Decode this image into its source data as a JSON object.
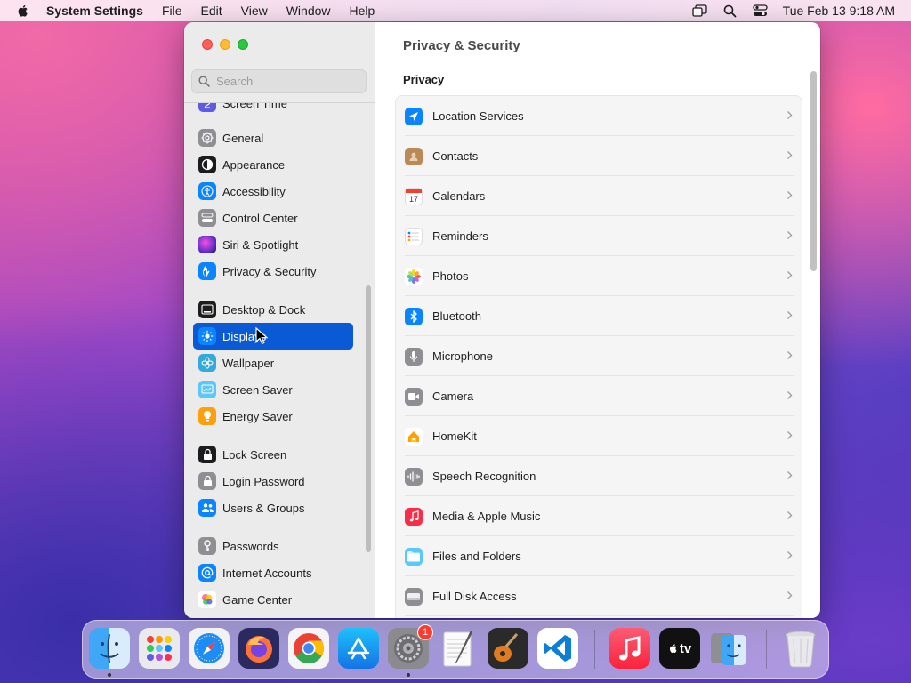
{
  "menubar": {
    "app_name": "System Settings",
    "menus": [
      "File",
      "Edit",
      "View",
      "Window",
      "Help"
    ],
    "clock": "Tue Feb 13  9:18 AM"
  },
  "window": {
    "search_placeholder": "Search",
    "partial_item": "Screen Time",
    "sidebar_groups": [
      [
        {
          "label": "General",
          "icon": "gear-icon",
          "color": "#8e8e93"
        },
        {
          "label": "Appearance",
          "icon": "appearance-icon",
          "color": "#1c1c1e"
        },
        {
          "label": "Accessibility",
          "icon": "accessibility-icon",
          "color": "#0a84ff"
        },
        {
          "label": "Control Center",
          "icon": "control-center-icon",
          "color": "#8e8e93"
        },
        {
          "label": "Siri & Spotlight",
          "icon": "siri-icon",
          "color": "#5e2fd0"
        },
        {
          "label": "Privacy & Security",
          "icon": "hand-icon",
          "color": "#0a84ff"
        }
      ],
      [
        {
          "label": "Desktop & Dock",
          "icon": "dock-icon",
          "color": "#1c1c1e"
        },
        {
          "label": "Displays",
          "icon": "displays-icon",
          "color": "#0a84ff",
          "selected": true
        },
        {
          "label": "Wallpaper",
          "icon": "wallpaper-icon",
          "color": "#34aadc"
        },
        {
          "label": "Screen Saver",
          "icon": "screen-saver-icon",
          "color": "#5ac8fa"
        },
        {
          "label": "Energy Saver",
          "icon": "bulb-icon",
          "color": "#ff9f0a"
        }
      ],
      [
        {
          "label": "Lock Screen",
          "icon": "lock-icon",
          "color": "#1c1c1e"
        },
        {
          "label": "Login Password",
          "icon": "login-lock-icon",
          "color": "#8e8e93"
        },
        {
          "label": "Users & Groups",
          "icon": "users-icon",
          "color": "#0a84ff"
        }
      ],
      [
        {
          "label": "Passwords",
          "icon": "key-icon",
          "color": "#8e8e93"
        },
        {
          "label": "Internet Accounts",
          "icon": "at-icon",
          "color": "#0a84ff"
        },
        {
          "label": "Game Center",
          "icon": "game-center-icon",
          "color": "#ffffff"
        }
      ]
    ],
    "main": {
      "title": "Privacy & Security",
      "section": "Privacy",
      "rows": [
        {
          "label": "Location Services",
          "icon": "location-icon",
          "color": "#0a84ff"
        },
        {
          "label": "Contacts",
          "icon": "contacts-icon",
          "color": "#b98a55"
        },
        {
          "label": "Calendars",
          "icon": "calendar-icon",
          "color": "#ffffff"
        },
        {
          "label": "Reminders",
          "icon": "reminders-icon",
          "color": "#ffffff"
        },
        {
          "label": "Photos",
          "icon": "photos-icon",
          "color": "#ffffff"
        },
        {
          "label": "Bluetooth",
          "icon": "bluetooth-icon",
          "color": "#0a84ff"
        },
        {
          "label": "Microphone",
          "icon": "microphone-icon",
          "color": "#8e8e93"
        },
        {
          "label": "Camera",
          "icon": "camera-icon",
          "color": "#8e8e93"
        },
        {
          "label": "HomeKit",
          "icon": "home-icon",
          "color": "#ffffff"
        },
        {
          "label": "Speech Recognition",
          "icon": "waveform-icon",
          "color": "#8e8e93"
        },
        {
          "label": "Media & Apple Music",
          "icon": "music-note-icon",
          "color": "#fa2d48"
        },
        {
          "label": "Files and Folders",
          "icon": "folder-icon",
          "color": "#5ac8fa"
        },
        {
          "label": "Full Disk Access",
          "icon": "disk-icon",
          "color": "#8e8e93"
        }
      ]
    }
  },
  "dock": {
    "apps": [
      {
        "name": "finder-app",
        "running": true
      },
      {
        "name": "launchpad-app"
      },
      {
        "name": "safari-app"
      },
      {
        "name": "firefox-app"
      },
      {
        "name": "chrome-app"
      },
      {
        "name": "app-store-app"
      },
      {
        "name": "system-settings-app",
        "running": true,
        "badge": "1"
      },
      {
        "name": "textedit-app"
      },
      {
        "name": "garageband-app"
      },
      {
        "name": "vscode-app"
      },
      {
        "name": "music-app"
      },
      {
        "name": "apple-tv-app"
      },
      {
        "name": "migration-assistant-app"
      },
      {
        "name": "trash-app"
      }
    ],
    "tv_label": "tv"
  }
}
